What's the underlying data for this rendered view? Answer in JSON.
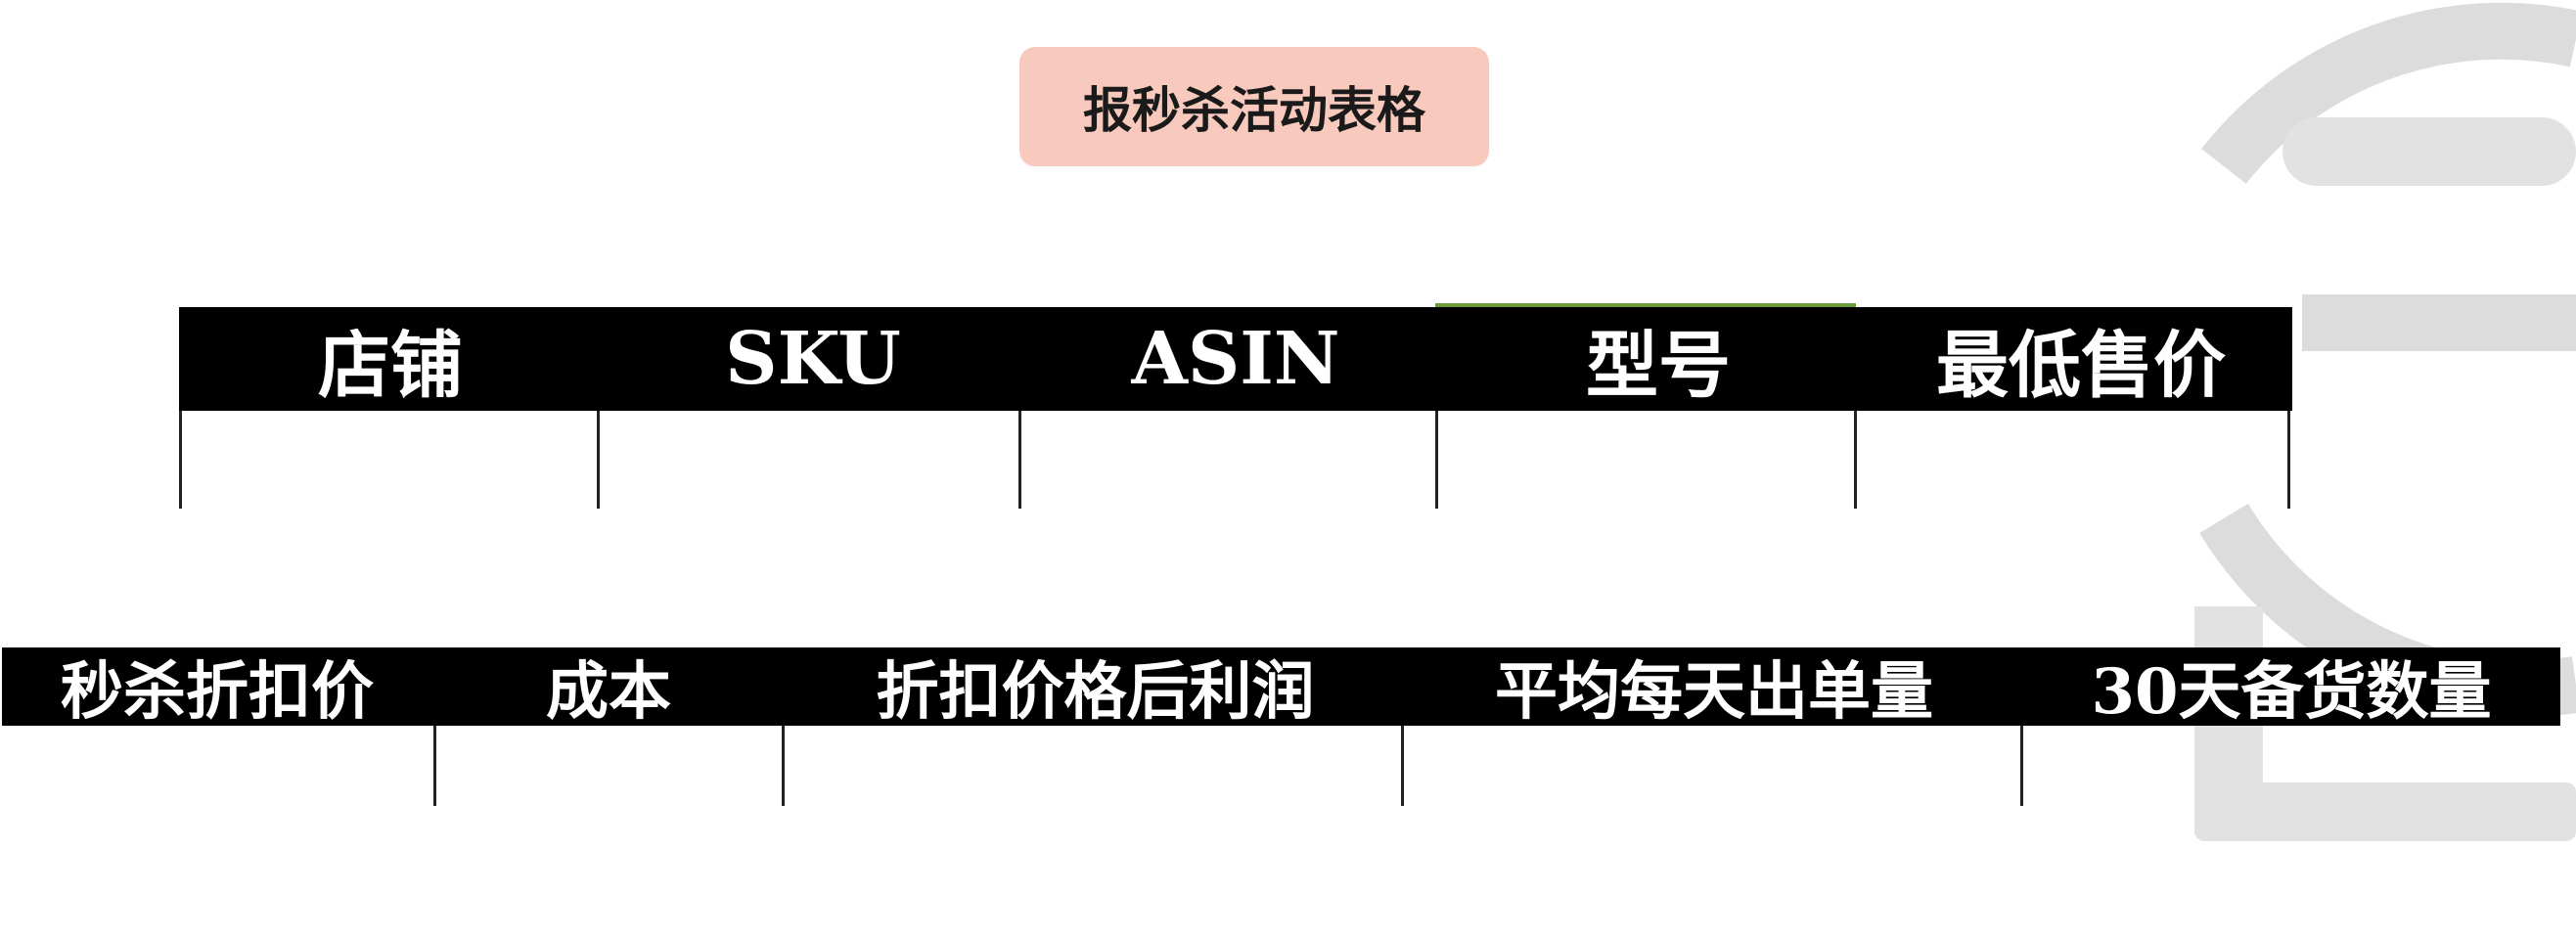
{
  "title": "报秒杀活动表格",
  "table_1": {
    "headers": [
      "店铺",
      "SKU",
      "ASIN",
      "型号",
      "最低售价"
    ],
    "rows": [
      [
        "",
        "",
        "",
        "",
        ""
      ]
    ]
  },
  "table_2": {
    "headers": [
      "秒杀折扣价",
      "成本",
      "折扣价格后利润",
      "平均每天出单量",
      "30天备货数量"
    ],
    "rows": [
      [
        "",
        "",
        "",
        "",
        ""
      ]
    ]
  },
  "colors": {
    "title_badge_bg": "#f8c9bd",
    "header_bg": "#000000",
    "header_text": "#ffffff",
    "accent_line": "#6a9a3a",
    "watermark": "#dcdcdc"
  },
  "icons": [
    "watermark-logo-icon"
  ]
}
